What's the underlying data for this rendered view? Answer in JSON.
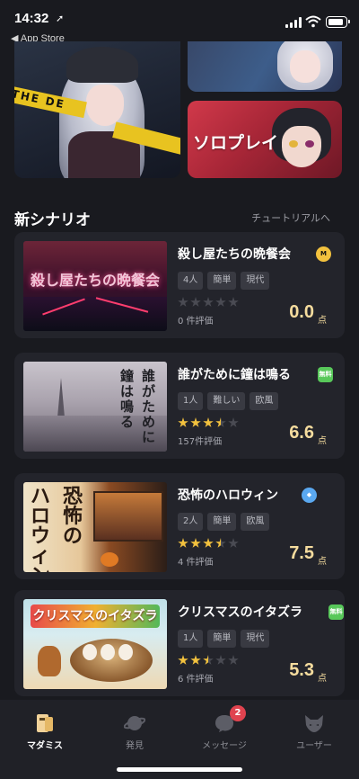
{
  "status_bar": {
    "time": "14:32",
    "location_icon": "location-arrow-icon",
    "back_app_label": "◀ App Store",
    "icons": [
      "signal-icon",
      "wifi-icon",
      "battery-icon"
    ]
  },
  "banners": {
    "solo_label": "ソロプレイ",
    "tape_text": "THE DE"
  },
  "section": {
    "title": "新シナリオ",
    "tutorial_link": "チュートリアルへ"
  },
  "thumb_text": {
    "card1": "殺し屋たちの晩餐会",
    "card2_col1": "誰がために",
    "card2_col2": "鐘は鳴る",
    "card3_col1": "恐怖の",
    "card3_col2": "ハロウィン",
    "card4": "クリスマスのイタズラ"
  },
  "scenarios": [
    {
      "title": "殺し屋たちの晩餐会",
      "badge": "M",
      "badge_color": "#f2c13e",
      "tags": [
        "4人",
        "簡単",
        "現代"
      ],
      "rating_stars": 0,
      "eval_count": "0 件評価",
      "score": "0.0",
      "score_unit": "点"
    },
    {
      "title": "誰がために鐘は鳴る",
      "badge": "無料",
      "badge_color": "#58c85a",
      "tags": [
        "1人",
        "難しい",
        "欧風"
      ],
      "rating_stars": 3.5,
      "eval_count": "157件評価",
      "score": "6.6",
      "score_unit": "点"
    },
    {
      "title": "恐怖のハロウィン",
      "badge": "◆",
      "badge_color": "#5aa8f0",
      "tags": [
        "2人",
        "簡単",
        "欧風"
      ],
      "rating_stars": 3.5,
      "eval_count": "4 件評価",
      "score": "7.5",
      "score_unit": "点"
    },
    {
      "title": "クリスマスのイタズラ",
      "badge": "無料",
      "badge_color": "#58c85a",
      "tags": [
        "1人",
        "簡単",
        "現代"
      ],
      "rating_stars": 2.5,
      "eval_count": "6 件評価",
      "score": "5.3",
      "score_unit": "点"
    }
  ],
  "bottom_nav": {
    "items": [
      {
        "label": "マダミス",
        "icon": "book-icon",
        "active": true
      },
      {
        "label": "発見",
        "icon": "planet-icon",
        "active": false
      },
      {
        "label": "メッセージ",
        "icon": "chat-bubble-icon",
        "active": false,
        "badge": "2"
      },
      {
        "label": "ユーザー",
        "icon": "user-mask-icon",
        "active": false
      }
    ]
  }
}
